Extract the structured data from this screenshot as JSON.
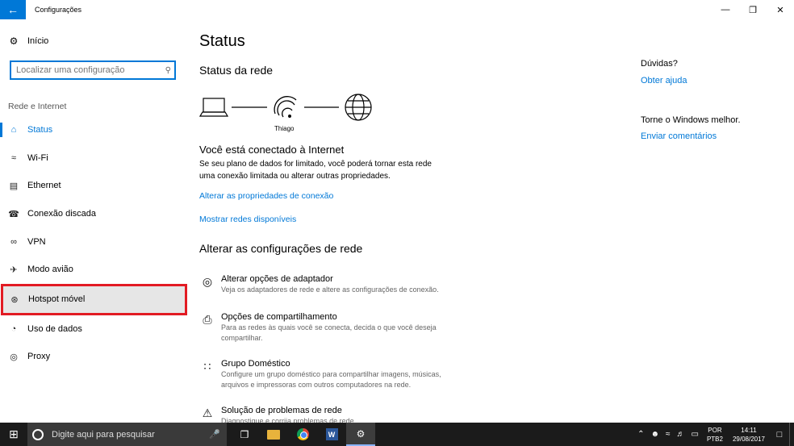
{
  "window": {
    "title": "Configurações",
    "back_icon": "arrow-left-icon"
  },
  "sidebar": {
    "home_label": "Início",
    "search_placeholder": "Localizar uma configuração",
    "section_label": "Rede e Internet",
    "items": [
      {
        "label": "Status",
        "icon": "status-icon"
      },
      {
        "label": "Wi-Fi",
        "icon": "wifi-icon"
      },
      {
        "label": "Ethernet",
        "icon": "ethernet-icon"
      },
      {
        "label": "Conexão discada",
        "icon": "dialup-icon"
      },
      {
        "label": "VPN",
        "icon": "vpn-icon"
      },
      {
        "label": "Modo avião",
        "icon": "airplane-icon"
      },
      {
        "label": "Hotspot móvel",
        "icon": "hotspot-icon"
      },
      {
        "label": "Uso de dados",
        "icon": "data-usage-icon"
      },
      {
        "label": "Proxy",
        "icon": "globe-icon"
      }
    ],
    "active_item": "Status",
    "highlighted_item": "Hotspot móvel",
    "highlight_color": "#e21b23"
  },
  "main": {
    "title": "Status",
    "network_status_heading": "Status da rede",
    "network_name": "Thiago",
    "connected_title": "Você está conectado à Internet",
    "connected_desc": "Se seu plano de dados for limitado, você poderá tornar esta rede uma conexão limitada ou alterar outras propriedades.",
    "link_properties": "Alterar as propriedades de conexão",
    "link_networks": "Mostrar redes disponíveis",
    "change_settings_heading": "Alterar as configurações de rede",
    "options": [
      {
        "title": "Alterar opções de adaptador",
        "desc": "Veja os adaptadores de rede e altere as configurações de conexão.",
        "icon": "adapter-icon"
      },
      {
        "title": "Opções de compartilhamento",
        "desc": "Para as redes às quais você se conecta, decida o que você deseja compartilhar.",
        "icon": "sharing-icon"
      },
      {
        "title": "Grupo Doméstico",
        "desc": "Configure um grupo doméstico para compartilhar imagens, músicas, arquivos e impressoras com outros computadores na rede.",
        "icon": "homegroup-icon"
      },
      {
        "title": "Solução de problemas de rede",
        "desc": "Diagnostique e corrija problemas de rede.",
        "icon": "warning-icon"
      }
    ]
  },
  "right": {
    "questions": "Dúvidas?",
    "get_help": "Obter ajuda",
    "improve": "Torne o Windows melhor.",
    "feedback": "Enviar comentários"
  },
  "taskbar": {
    "search_placeholder": "Digite aqui para pesquisar",
    "lang_top": "POR",
    "lang_bottom": "PTB2",
    "time": "14:11",
    "date": "29/08/2017"
  },
  "colors": {
    "accent": "#0078d7",
    "taskbar": "#1b1b1b"
  }
}
